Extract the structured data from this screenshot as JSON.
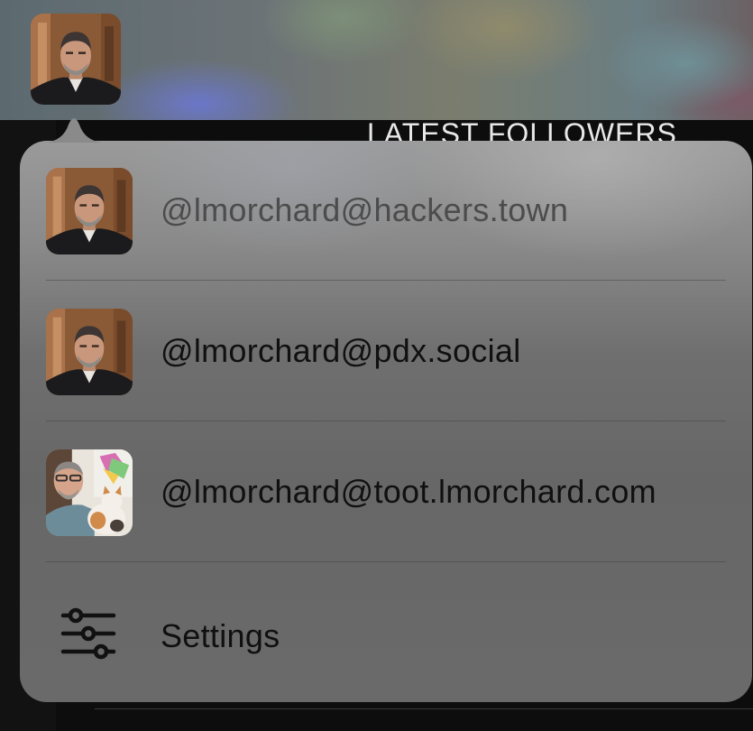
{
  "header": {
    "avatar_alt": "current account avatar",
    "section_heading": "LATEST FOLLOWERS"
  },
  "account_menu": {
    "accounts": [
      {
        "handle": "@lmorchard@hackers.town",
        "avatar_icon": "user-avatar-portrait",
        "current": true
      },
      {
        "handle": "@lmorchard@pdx.social",
        "avatar_icon": "user-avatar-portrait",
        "current": false
      },
      {
        "handle": "@lmorchard@toot.lmorchard.com",
        "avatar_icon": "user-avatar-with-cat",
        "current": false
      }
    ],
    "settings": {
      "label": "Settings",
      "icon": "sliders-icon"
    }
  },
  "colors": {
    "popover_background": "#7a7a7a",
    "menu_text": "#101010",
    "current_account_text": "#4c4c4c",
    "heading_text": "#e8e8e8",
    "page_background": "#0d0d0d"
  }
}
